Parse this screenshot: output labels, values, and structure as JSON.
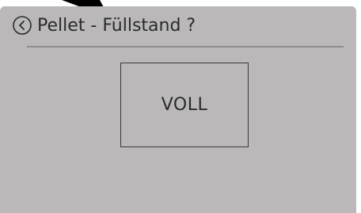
{
  "header": {
    "title": "Pellet - Füllstand ?",
    "back_icon": "chevron-left-circle-icon"
  },
  "options": [
    {
      "label": "VOLL"
    }
  ],
  "colors": {
    "panel_background": "#bab8b9",
    "text": "#2b2b2b",
    "divider": "#8e8c8d",
    "border": "#3a3a3a"
  }
}
